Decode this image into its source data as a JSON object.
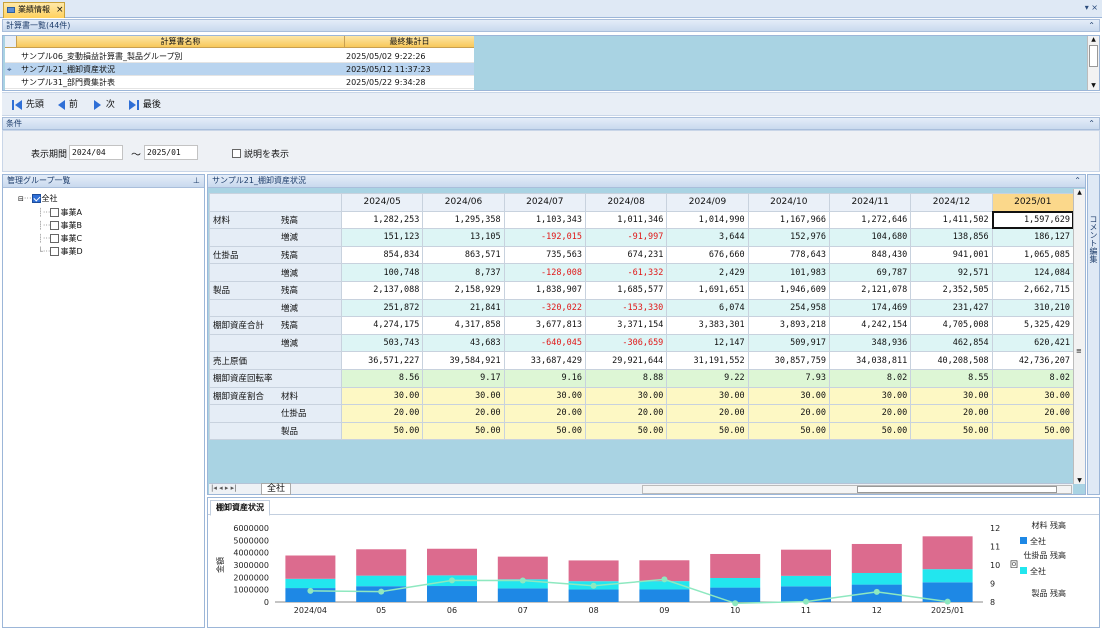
{
  "window": {
    "tab_label": "業績情報",
    "close": "×",
    "controls": "▾ ×"
  },
  "calc_list": {
    "header": "計算書一覧(44件)",
    "col_name": "計算書名称",
    "col_date": "最終集計日",
    "rows": [
      {
        "name": "サンプル06_変動損益計算書_製品グループ別",
        "date": "2025/05/02 9:22:26",
        "selected": false
      },
      {
        "name": "サンプル21_棚卸資産状況",
        "date": "2025/05/12 11:37:23",
        "selected": true
      },
      {
        "name": "サンプル31_部門費集計表",
        "date": "2025/05/22 9:34:28",
        "selected": false
      }
    ]
  },
  "nav": {
    "first": "先頭",
    "prev": "前",
    "next": "次",
    "last": "最後"
  },
  "conditions": {
    "header": "条件",
    "period_label": "表示期間",
    "from": "2024/04",
    "tilde": "～",
    "to": "2025/01",
    "show_desc": "説明を表示"
  },
  "group_panel": {
    "header": "管理グループ一覧",
    "root": "全社",
    "children": [
      "事業A",
      "事業B",
      "事業C",
      "事業D"
    ]
  },
  "grid": {
    "header": "サンプル21_棚卸資産状況",
    "months": [
      "2024/05",
      "2024/06",
      "2024/07",
      "2024/08",
      "2024/09",
      "2024/10",
      "2024/11",
      "2024/12",
      "2025/01"
    ],
    "sheet_tab": "全社",
    "rows": [
      {
        "group": "材料",
        "item": "残高",
        "kind": "zr",
        "values": [
          "1,282,253",
          "1,295,358",
          "1,103,343",
          "1,011,346",
          "1,014,990",
          "1,167,966",
          "1,272,646",
          "1,411,502",
          "1,597,629"
        ]
      },
      {
        "group": "",
        "item": "増減",
        "kind": "zz",
        "values": [
          "151,123",
          "13,105",
          "-192,015",
          "-91,997",
          "3,644",
          "152,976",
          "104,680",
          "138,856",
          "186,127"
        ]
      },
      {
        "group": "仕掛品",
        "item": "残高",
        "kind": "zr",
        "values": [
          "854,834",
          "863,571",
          "735,563",
          "674,231",
          "676,660",
          "778,643",
          "848,430",
          "941,001",
          "1,065,085"
        ]
      },
      {
        "group": "",
        "item": "増減",
        "kind": "zz",
        "values": [
          "100,748",
          "8,737",
          "-128,008",
          "-61,332",
          "2,429",
          "101,983",
          "69,787",
          "92,571",
          "124,084"
        ]
      },
      {
        "group": "製品",
        "item": "残高",
        "kind": "zr",
        "values": [
          "2,137,088",
          "2,158,929",
          "1,838,907",
          "1,685,577",
          "1,691,651",
          "1,946,609",
          "2,121,078",
          "2,352,505",
          "2,662,715"
        ]
      },
      {
        "group": "",
        "item": "増減",
        "kind": "zz",
        "values": [
          "251,872",
          "21,841",
          "-320,022",
          "-153,330",
          "6,074",
          "254,958",
          "174,469",
          "231,427",
          "310,210"
        ]
      },
      {
        "group": "棚卸資産合計",
        "item": "残高",
        "kind": "zr",
        "values": [
          "4,274,175",
          "4,317,858",
          "3,677,813",
          "3,371,154",
          "3,383,301",
          "3,893,218",
          "4,242,154",
          "4,705,008",
          "5,325,429"
        ]
      },
      {
        "group": "",
        "item": "増減",
        "kind": "zz",
        "values": [
          "503,743",
          "43,683",
          "-640,045",
          "-306,659",
          "12,147",
          "509,917",
          "348,936",
          "462,854",
          "620,421"
        ]
      },
      {
        "group": "売上原価",
        "item": "",
        "kind": "zr",
        "values": [
          "36,571,227",
          "39,584,921",
          "33,687,429",
          "29,921,644",
          "31,191,552",
          "30,857,759",
          "34,038,811",
          "40,208,508",
          "42,736,207"
        ]
      },
      {
        "group": "棚卸資産回転率",
        "item": "",
        "kind": "ratio",
        "values": [
          "8.56",
          "9.17",
          "9.16",
          "8.88",
          "9.22",
          "7.93",
          "8.02",
          "8.55",
          "8.02"
        ]
      },
      {
        "group": "棚卸資産割合",
        "item": "材料",
        "kind": "mix",
        "values": [
          "30.00",
          "30.00",
          "30.00",
          "30.00",
          "30.00",
          "30.00",
          "30.00",
          "30.00",
          "30.00"
        ]
      },
      {
        "group": "",
        "item": "仕掛品",
        "kind": "mix",
        "values": [
          "20.00",
          "20.00",
          "20.00",
          "20.00",
          "20.00",
          "20.00",
          "20.00",
          "20.00",
          "20.00"
        ]
      },
      {
        "group": "",
        "item": "製品",
        "kind": "mix",
        "values": [
          "50.00",
          "50.00",
          "50.00",
          "50.00",
          "50.00",
          "50.00",
          "50.00",
          "50.00",
          "50.00"
        ]
      }
    ]
  },
  "comment_tab": "コメント編集",
  "chart_tab": "棚卸資産状況",
  "chart_data": {
    "type": "bar",
    "categories": [
      "2024/04",
      "05",
      "06",
      "07",
      "08",
      "09",
      "10",
      "11",
      "12",
      "2025/01"
    ],
    "ylabel": "金額",
    "y2label": "回",
    "ylim": [
      0,
      6000000
    ],
    "y_ticks": [
      "0",
      "1000000",
      "2000000",
      "3000000",
      "4000000",
      "5000000",
      "6000000"
    ],
    "y2lim": [
      8,
      12
    ],
    "y2_ticks": [
      "8",
      "9",
      "10",
      "11",
      "12"
    ],
    "stacked": true,
    "series": [
      {
        "name": "材料 残高",
        "sub": "全社",
        "color": "#1e88e5",
        "values": [
          1130000,
          1282253,
          1295358,
          1103343,
          1011346,
          1014990,
          1167966,
          1272646,
          1411502,
          1597629
        ]
      },
      {
        "name": "仕掛品 残高",
        "sub": "全社",
        "color": "#22e6ee",
        "values": [
          750000,
          854834,
          863571,
          735563,
          674231,
          676660,
          778643,
          848430,
          941001,
          1065085
        ]
      },
      {
        "name": "製品 残高",
        "sub": "",
        "color": "#dc6b8e",
        "values": [
          1890000,
          2137088,
          2158929,
          1838907,
          1685577,
          1691651,
          1946609,
          2121078,
          2352505,
          2662715
        ]
      }
    ],
    "line": {
      "name": "棚卸資産回転率",
      "color": "#8ee8c0",
      "axis": "right",
      "values": [
        8.6,
        8.56,
        9.17,
        9.16,
        8.88,
        9.22,
        7.93,
        8.02,
        8.55,
        8.02
      ]
    }
  }
}
